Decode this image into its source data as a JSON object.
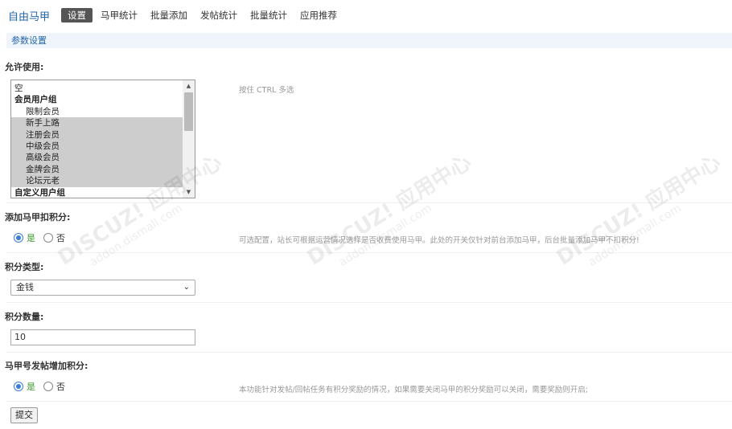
{
  "nav": {
    "brand": "自由马甲",
    "items": [
      {
        "label": "设置",
        "active": true
      },
      {
        "label": "马甲统计"
      },
      {
        "label": "批量添加"
      },
      {
        "label": "发帖统计"
      },
      {
        "label": "批量统计"
      },
      {
        "label": "应用推荐"
      }
    ]
  },
  "section": {
    "title": "参数设置"
  },
  "allow": {
    "label": "允许使用:",
    "tip": "按住 CTRL 多选",
    "options": [
      {
        "label": "空",
        "kind": "plain",
        "selected": false
      },
      {
        "label": "会员用户组",
        "kind": "group",
        "selected": false
      },
      {
        "label": "限制会员",
        "kind": "child",
        "selected": false
      },
      {
        "label": "新手上路",
        "kind": "child",
        "selected": true
      },
      {
        "label": "注册会员",
        "kind": "child",
        "selected": true
      },
      {
        "label": "中级会员",
        "kind": "child",
        "selected": true
      },
      {
        "label": "高级会员",
        "kind": "child",
        "selected": true
      },
      {
        "label": "金牌会员",
        "kind": "child",
        "selected": true
      },
      {
        "label": "论坛元老",
        "kind": "child",
        "selected": true
      },
      {
        "label": "自定义用户组",
        "kind": "group",
        "selected": false
      }
    ]
  },
  "deduct": {
    "label": "添加马甲扣积分:",
    "yes": "是",
    "no": "否",
    "selected": "yes",
    "tip": "可选配置，站长可根据运营情况选择是否收费使用马甲。此处的开关仅针对前台添加马甲，后台批量添加马甲不扣积分!"
  },
  "credit_type": {
    "label": "积分类型:",
    "value": "金钱",
    "arrow": "⌄"
  },
  "credit_amount": {
    "label": "积分数量:",
    "value": "10"
  },
  "post_bonus": {
    "label": "马甲号发帖增加积分:",
    "yes": "是",
    "no": "否",
    "selected": "yes",
    "tip": "本功能针对发帖/回帖任务有积分奖励的情况，如果需要关闭马甲的积分奖励可以关闭，需要奖励则开启;"
  },
  "submit": {
    "label": "提交"
  },
  "scroll": {
    "up": "▲",
    "down": "▼"
  },
  "colors": {
    "accent": "#2366a8",
    "section_bg": "#f0f5fb",
    "radio_on": "#3b7dd8",
    "yes_text": "#3b9a2b"
  }
}
